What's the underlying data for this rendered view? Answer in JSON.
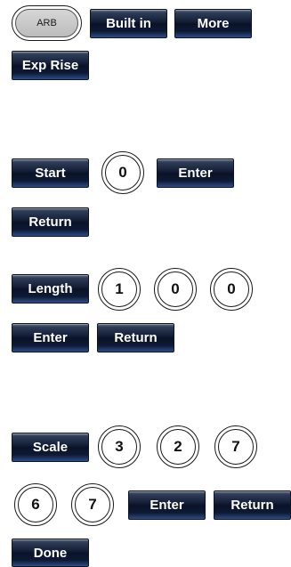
{
  "row1": {
    "arb": "ARB",
    "built_in": "Built in",
    "more": "More"
  },
  "row2": {
    "exp_rise": "Exp Rise"
  },
  "start_row": {
    "start": "Start",
    "digit": "0",
    "enter": "Enter"
  },
  "start_return": "Return",
  "length_row": {
    "length": "Length",
    "digits": [
      "1",
      "0",
      "0"
    ]
  },
  "length_buttons": {
    "enter": "Enter",
    "return": "Return"
  },
  "scale_row": {
    "scale": "Scale",
    "digits": [
      "3",
      "2",
      "7"
    ]
  },
  "scale_row2": {
    "digits": [
      "6",
      "7"
    ],
    "enter": "Enter",
    "return": "Return"
  },
  "done": "Done"
}
